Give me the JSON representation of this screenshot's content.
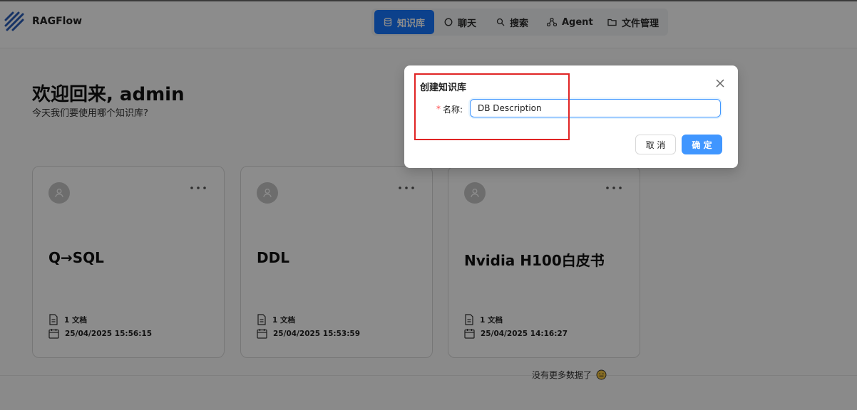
{
  "app": {
    "brand": "RAGFlow"
  },
  "nav": [
    {
      "label": "知识库",
      "icon": "database-icon",
      "active": true
    },
    {
      "label": "聊天",
      "icon": "chat-icon",
      "active": false
    },
    {
      "label": "搜索",
      "icon": "search-icon",
      "active": false
    },
    {
      "label": "Agent",
      "icon": "agent-icon",
      "active": false
    },
    {
      "label": "文件管理",
      "icon": "folder-icon",
      "active": false
    }
  ],
  "welcome": {
    "title": "欢迎回来, admin",
    "subtitle": "今天我们要使用哪个知识库?"
  },
  "cards": [
    {
      "title": "Q→SQL",
      "docs": "1  文档",
      "date": "25/04/2025 15:56:15"
    },
    {
      "title": "DDL",
      "docs": "1  文档",
      "date": "25/04/2025 15:53:59"
    },
    {
      "title": "Nvidia H100白皮书",
      "docs": "1  文档",
      "date": "25/04/2025 14:16:27"
    }
  ],
  "footer": {
    "no_more": "没有更多数据了"
  },
  "modal": {
    "title": "创建知识库",
    "required_mark": "*",
    "name_label": "名称:",
    "name_value": "DB Description",
    "cancel_label": "取 消",
    "ok_label": "确 定"
  },
  "colors": {
    "primary": "#1677ff",
    "highlight": "#e02424"
  }
}
